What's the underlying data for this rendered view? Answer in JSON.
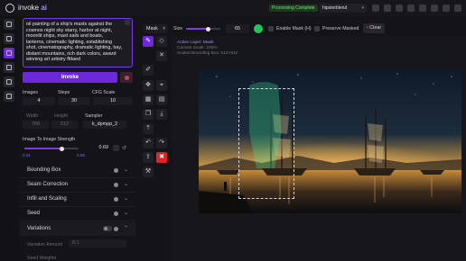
{
  "app": {
    "name_part1": "invoke",
    "name_part2": "ai",
    "status": "Processing Complete",
    "model": "hipsterblend"
  },
  "prompt": {
    "text": "oil painting of a ship's masts against the cosmos night sky starry, harbor at night, moonlit ships, mast sails and boats, lanterns, cinematic lighting, establishing shot, cinematography, dramatic lighting, bay, distant mountains, rich dark colors, award winning art artistry ffdaed",
    "invoke_label": "Invoke"
  },
  "params": {
    "images_label": "Images",
    "images_value": "4",
    "steps_label": "Steps",
    "steps_value": "30",
    "cfg_label": "CFG Scale",
    "cfg_value": "10",
    "width_label": "Width",
    "width_value": "768",
    "height_label": "Height",
    "height_value": "512",
    "sampler_label": "Sampler",
    "sampler_value": "k_dpmpp_2",
    "strength_label": "Image To Image Strength",
    "strength_value": "0.69",
    "strength_min": "0.01",
    "strength_max": "0.99",
    "strength_level": 0.69
  },
  "accordions": [
    {
      "title": "Bounding Box"
    },
    {
      "title": "Seam Correction"
    },
    {
      "title": "Infill and Scaling"
    },
    {
      "title": "Seed"
    },
    {
      "title": "Variations"
    }
  ],
  "variations": {
    "amount_label": "Variation Amount",
    "amount_value": "0.1",
    "weights_label": "Seed Weights"
  },
  "canvas_controls": {
    "layer": "Mask",
    "size_label": "Size",
    "size_value": "65",
    "enable_mask": "Enable Mask (H)",
    "preserve_masked": "Preserve Masked",
    "clear": "Clear"
  },
  "canvas_info": {
    "active_layer": "Active Layer: Mask",
    "canvas_scale": "Canvas Scale: 100%",
    "scaled_bbox": "Scaled Bounding Box: 512×512"
  },
  "colors": {
    "accent": "#6d28d9",
    "status_green": "#22c55e",
    "danger": "#dc2626"
  }
}
